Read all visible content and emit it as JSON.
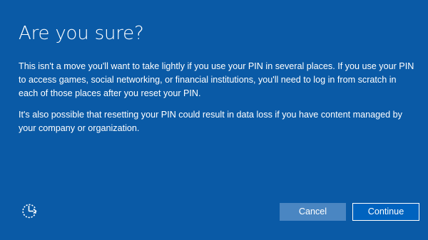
{
  "dialog": {
    "title": "Are you sure?",
    "paragraph1": "This isn't a move you'll want to take lightly if you use your PIN in several places. If you use your PIN to access games, social networking, or financial institutions, you'll need to log in from scratch in each of those places after you reset your PIN.",
    "paragraph2": "It's also possible that resetting your PIN could result in data loss if you have content managed by your company or organization."
  },
  "footer": {
    "accessibility_icon": "ease-of-access-icon",
    "cancel_label": "Cancel",
    "continue_label": "Continue"
  },
  "colors": {
    "background": "#0a5aa6",
    "cancel_button": "#4a86c2",
    "continue_button": "#0063bf",
    "text": "#ffffff"
  }
}
